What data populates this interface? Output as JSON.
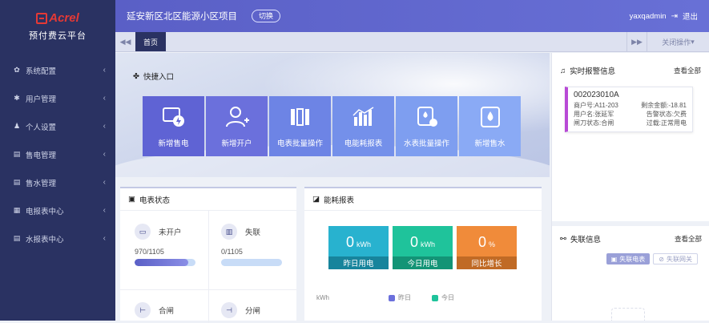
{
  "brand": {
    "logo_text": "Acrel",
    "subtitle": "预付费云平台"
  },
  "sidebar": {
    "items": [
      {
        "label": "系统配置",
        "icon": "gear-icon"
      },
      {
        "label": "用户管理",
        "icon": "wrench-icon"
      },
      {
        "label": "个人设置",
        "icon": "person-icon"
      },
      {
        "label": "售电管理",
        "icon": "list-icon"
      },
      {
        "label": "售水管理",
        "icon": "list-icon"
      },
      {
        "label": "电报表中心",
        "icon": "grid-icon"
      },
      {
        "label": "水报表中心",
        "icon": "list-icon"
      }
    ]
  },
  "topbar": {
    "project_title": "延安新区北区能源小区项目",
    "switch_label": "切换",
    "username": "yaxqadmin",
    "logout_label": "退出"
  },
  "tabbar": {
    "home_tab": "首页",
    "close_tabs": "关闭操作"
  },
  "quick_entry": {
    "title": "快捷入口",
    "tiles": [
      {
        "label": "新增售电",
        "icon": "sell-power-icon"
      },
      {
        "label": "新增开户",
        "icon": "add-user-icon"
      },
      {
        "label": "电表批量操作",
        "icon": "meter-batch-icon"
      },
      {
        "label": "电能耗报表",
        "icon": "bar-chart-icon"
      },
      {
        "label": "水表批量操作",
        "icon": "water-meter-icon"
      },
      {
        "label": "新增售水",
        "icon": "water-drop-icon"
      }
    ]
  },
  "meter_status": {
    "title": "电表状态",
    "cells": [
      {
        "label": "未开户",
        "value": "970/1105",
        "fraction": 0.878
      },
      {
        "label": "失联",
        "value": "0/1105",
        "fraction": 0
      },
      {
        "label": "合闸"
      },
      {
        "label": "分闸"
      }
    ]
  },
  "energy_report": {
    "title": "能耗报表",
    "stats": [
      {
        "value": "0",
        "unit": "kWh",
        "label": "昨日用电",
        "color": "#28b2cf"
      },
      {
        "value": "0",
        "unit": "kWh",
        "label": "今日用电",
        "color": "#1fc39b"
      },
      {
        "value": "0",
        "unit": "%",
        "label": "同比增长",
        "color": "#f08b3a"
      }
    ],
    "axis_unit": "kWh",
    "legend": [
      {
        "label": "昨日",
        "color": "#6b70dc"
      },
      {
        "label": "今日",
        "color": "#1fc39b"
      }
    ]
  },
  "alarms": {
    "title": "实时报警信息",
    "view_all": "查看全部",
    "items": [
      {
        "code": "002023010A",
        "house_no": "商户号:A11-203",
        "balance": "剩余金额:-18.81",
        "user_name": "用户名:张延军",
        "alarm_state": "告警状态:欠费",
        "switch_state": "闸刀状态:合闸",
        "overload": "过载:正常用电"
      }
    ]
  },
  "lost_contact": {
    "title": "失联信息",
    "view_all": "查看全部",
    "btn_meter": "失联电表",
    "btn_gateway": "失联网关"
  }
}
